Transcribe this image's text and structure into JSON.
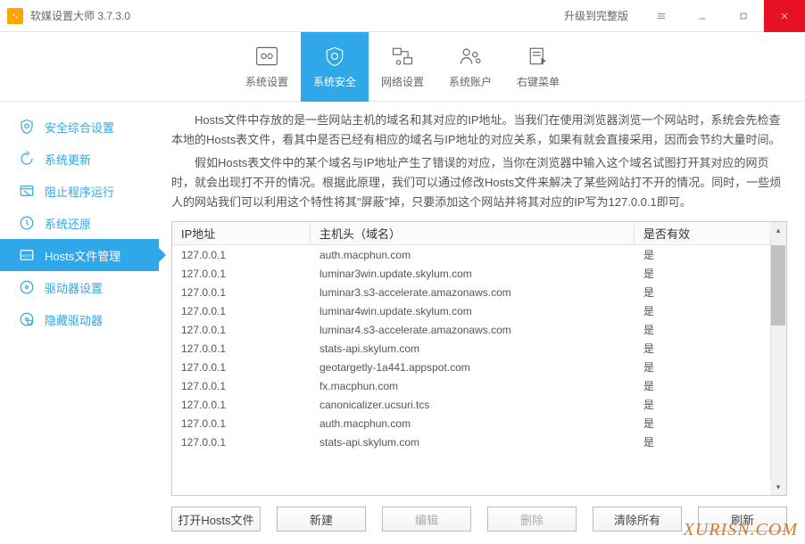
{
  "titlebar": {
    "app_title": "软媒设置大师 3.7.3.0",
    "upgrade": "升级到完整版"
  },
  "topnav": [
    {
      "label": "系统设置"
    },
    {
      "label": "系统安全"
    },
    {
      "label": "网络设置"
    },
    {
      "label": "系统账户"
    },
    {
      "label": "右键菜单"
    }
  ],
  "sidebar": [
    {
      "label": "安全综合设置"
    },
    {
      "label": "系统更新"
    },
    {
      "label": "阻止程序运行"
    },
    {
      "label": "系统还原"
    },
    {
      "label": "Hosts文件管理"
    },
    {
      "label": "驱动器设置"
    },
    {
      "label": "隐藏驱动器"
    }
  ],
  "desc": {
    "p1": "Hosts文件中存放的是一些网站主机的域名和其对应的IP地址。当我们在使用浏览器浏览一个网站时，系统会先检查本地的Hosts表文件，看其中是否已经有相应的域名与IP地址的对应关系，如果有就会直接采用，因而会节约大量时间。",
    "p2": "假如Hosts表文件中的某个域名与IP地址产生了错误的对应，当你在浏览器中输入这个域名试图打开其对应的网页时，就会出现打不开的情况。根据此原理，我们可以通过修改Hosts文件来解决了某些网站打不开的情况。同时，一些烦人的网站我们可以利用这个特性将其\"屏蔽\"掉，只要添加这个网站并将其对应的IP写为127.0.0.1即可。"
  },
  "table": {
    "headers": {
      "ip": "IP地址",
      "host": "主机头（域名）",
      "enabled": "是否有效"
    },
    "rows": [
      {
        "ip": "127.0.0.1",
        "host": "auth.macphun.com",
        "enabled": "是"
      },
      {
        "ip": "127.0.0.1",
        "host": "luminar3win.update.skylum.com",
        "enabled": "是"
      },
      {
        "ip": "127.0.0.1",
        "host": "luminar3.s3-accelerate.amazonaws.com",
        "enabled": "是"
      },
      {
        "ip": "127.0.0.1",
        "host": "luminar4win.update.skylum.com",
        "enabled": "是"
      },
      {
        "ip": "127.0.0.1",
        "host": "luminar4.s3-accelerate.amazonaws.com",
        "enabled": "是"
      },
      {
        "ip": "127.0.0.1",
        "host": "stats-api.skylum.com",
        "enabled": "是"
      },
      {
        "ip": "127.0.0.1",
        "host": "geotargetly-1a441.appspot.com",
        "enabled": "是"
      },
      {
        "ip": "127.0.0.1",
        "host": "fx.macphun.com",
        "enabled": "是"
      },
      {
        "ip": "127.0.0.1",
        "host": "canonicalizer.ucsuri.tcs",
        "enabled": "是"
      },
      {
        "ip": "127.0.0.1",
        "host": "auth.macphun.com",
        "enabled": "是"
      },
      {
        "ip": "127.0.0.1",
        "host": "stats-api.skylum.com",
        "enabled": "是"
      }
    ]
  },
  "buttons": {
    "open": "打开Hosts文件",
    "new": "新建",
    "edit": "编辑",
    "delete": "删除",
    "clear_all": "清除所有",
    "refresh": "刷新"
  },
  "watermark": "XURISN.COM"
}
